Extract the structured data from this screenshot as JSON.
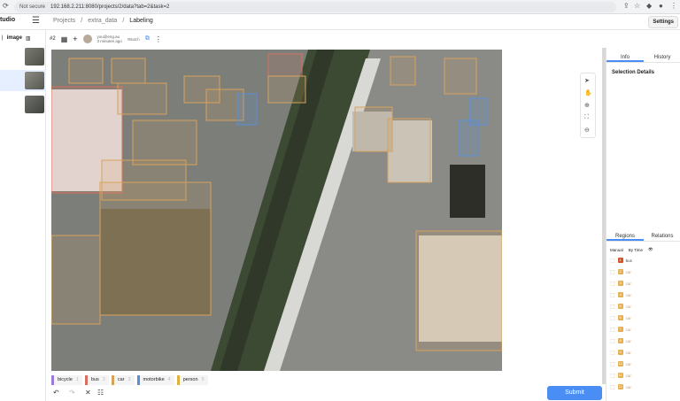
{
  "browser": {
    "security": "Not secure",
    "url": "192.168.2.211:8080/projects/2/data?tab=2&task=2"
  },
  "app": {
    "logo": "tudio",
    "breadcrumbs": [
      "Projects",
      "extra_data",
      "Labeling"
    ],
    "settings_label": "Settings"
  },
  "left": {
    "image_label": "image",
    "thumbnails": 3
  },
  "task": {
    "id": "#2",
    "user": "you@eng.au",
    "updated": "3 minutes ago",
    "badge": "#Batch"
  },
  "labels": [
    {
      "name": "bicycle",
      "hotkey": "1",
      "color": "#9b7bd6"
    },
    {
      "name": "bus",
      "hotkey": "2",
      "color": "#d77060"
    },
    {
      "name": "car",
      "hotkey": "3",
      "color": "#d6a35c"
    },
    {
      "name": "motorbike",
      "hotkey": "4",
      "color": "#5a8fd6"
    },
    {
      "name": "person",
      "hotkey": "5",
      "color": "#e0b040"
    }
  ],
  "bottom": {
    "submit_label": "Submit"
  },
  "right": {
    "tabs_top": [
      "Info",
      "History"
    ],
    "selection_details": "Selection Details",
    "tabs_bottom": [
      "Regions",
      "Relations"
    ],
    "toolbar": [
      "Manual",
      "By Time"
    ],
    "regions": [
      "bus",
      "car",
      "car",
      "car",
      "car",
      "car",
      "car",
      "car",
      "car",
      "car",
      "car",
      "car",
      "car",
      "car"
    ]
  }
}
